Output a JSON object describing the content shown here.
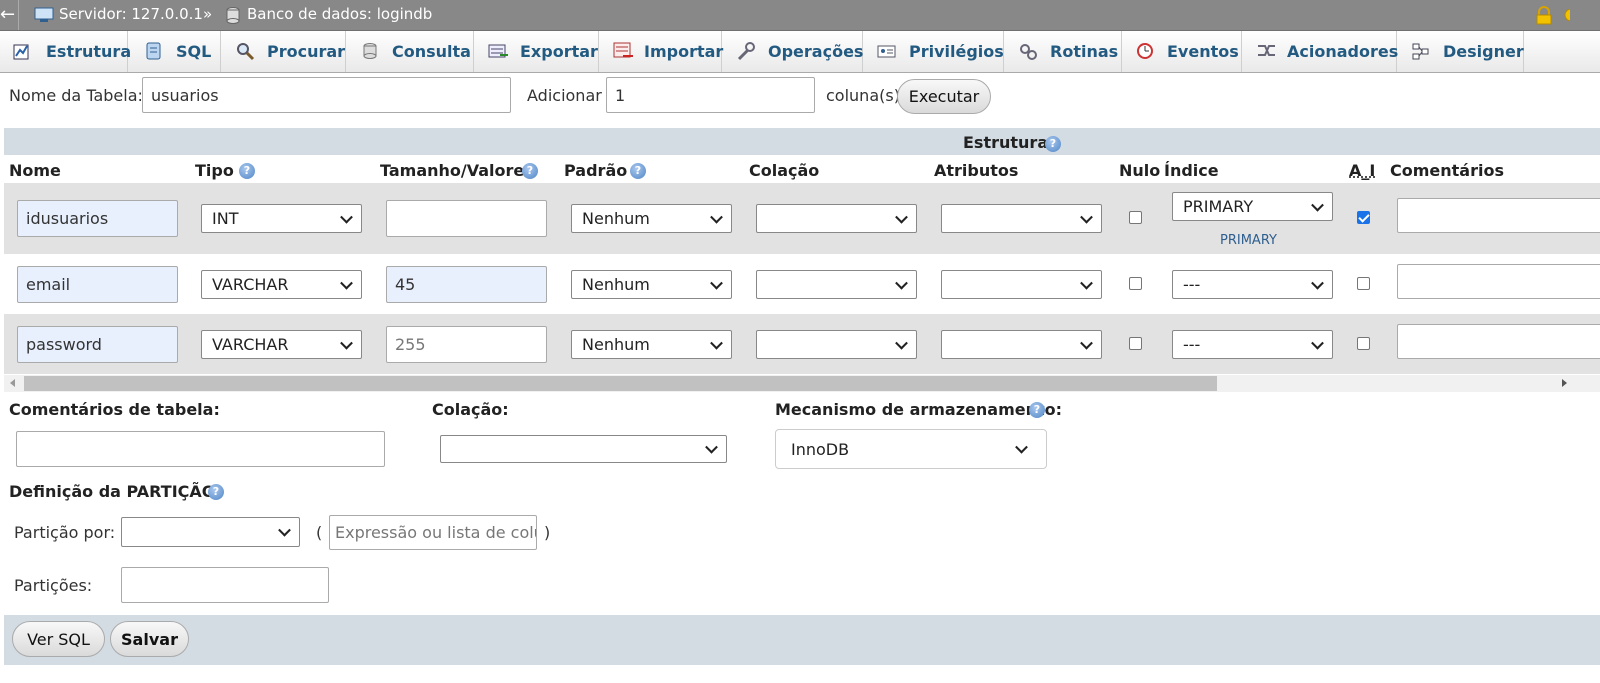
{
  "breadcrumb": {
    "back_glyph": "←",
    "server": "Servidor: 127.0.0.1",
    "sep": "»",
    "database": "Banco de dados: logindb"
  },
  "tabs": [
    {
      "label": "Estrutura",
      "icon": "structure-icon"
    },
    {
      "label": "SQL",
      "icon": "sql-icon"
    },
    {
      "label": "Procurar",
      "icon": "search-icon"
    },
    {
      "label": "Consulta",
      "icon": "query-icon"
    },
    {
      "label": "Exportar",
      "icon": "export-icon"
    },
    {
      "label": "Importar",
      "icon": "import-icon"
    },
    {
      "label": "Operações",
      "icon": "wrench-icon"
    },
    {
      "label": "Privilégios",
      "icon": "privileges-icon"
    },
    {
      "label": "Rotinas",
      "icon": "routines-icon"
    },
    {
      "label": "Eventos",
      "icon": "clock-icon"
    },
    {
      "label": "Acionadores",
      "icon": "triggers-icon"
    },
    {
      "label": "Designer",
      "icon": "designer-icon"
    }
  ],
  "table_form": {
    "name_label": "Nome da Tabela:",
    "name_value": "usuarios",
    "add_label": "Adicionar",
    "add_value": "1",
    "columns_label": "coluna(s)",
    "execute_button": "Executar"
  },
  "structure": {
    "title": "Estrutura",
    "headers": {
      "nome": "Nome",
      "tipo": "Tipo",
      "tamanho": "Tamanho/Valores",
      "padrao": "Padrão",
      "colacao": "Colação",
      "atributos": "Atributos",
      "nulo": "Nulo",
      "indice": "Índice",
      "ai": "A_I",
      "comentarios": "Comentários"
    },
    "rows": [
      {
        "name": "idusuarios",
        "type": "INT",
        "length": "",
        "length_placeholder": "",
        "default": "Nenhum",
        "collation": "",
        "attributes": "",
        "null": false,
        "index": "PRIMARY",
        "index_note": "PRIMARY",
        "ai": true,
        "comment": ""
      },
      {
        "name": "email",
        "type": "VARCHAR",
        "length": "45",
        "length_placeholder": "",
        "default": "Nenhum",
        "collation": "",
        "attributes": "",
        "null": false,
        "index": "---",
        "index_note": "",
        "ai": false,
        "comment": ""
      },
      {
        "name": "password",
        "type": "VARCHAR",
        "length": "",
        "length_placeholder": "255",
        "default": "Nenhum",
        "collation": "",
        "attributes": "",
        "null": false,
        "index": "---",
        "index_note": "",
        "ai": false,
        "comment": ""
      }
    ]
  },
  "table_options": {
    "comments_label": "Comentários de tabela:",
    "comments_value": "",
    "collation_label": "Colação:",
    "collation_value": "",
    "engine_label": "Mecanismo de armazenamento:",
    "engine_value": "InnoDB"
  },
  "partition": {
    "title": "Definição da PARTIÇÃO:",
    "by_label": "Partição por:",
    "by_value": "",
    "open_paren": "(",
    "close_paren": ")",
    "expression_placeholder": "Expressão ou lista de colun",
    "partitions_label": "Partições:",
    "partitions_value": ""
  },
  "footer": {
    "preview_sql_button": "Ver SQL",
    "save_button": "Salvar"
  },
  "colors": {
    "topbar": "#888888",
    "tab_text": "#235a81",
    "row_alt": "#e2e2e2",
    "section_band": "#d3dce3",
    "checkbox_on": "#1a73e8",
    "input_highlight": "#e8f0fe"
  }
}
